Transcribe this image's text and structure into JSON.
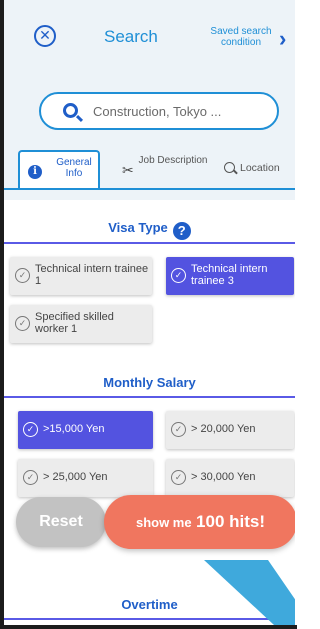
{
  "header": {
    "close_glyph": "✕",
    "title": "Search",
    "saved_link": "Saved search condition",
    "chevron_glyph": "›"
  },
  "search": {
    "placeholder": "Construction, Tokyo ..."
  },
  "tabs": [
    {
      "icon": "info-icon",
      "label": "General Info",
      "active": true
    },
    {
      "icon": "tools-icon",
      "label": "Job Description",
      "active": false
    },
    {
      "icon": "location-search-icon",
      "label": "Location",
      "active": false
    }
  ],
  "visa_type": {
    "title": "Visa Type",
    "help_glyph": "?",
    "options": [
      {
        "label": "Technical intern trainee 1",
        "selected": false
      },
      {
        "label": "Technical intern trainee 3",
        "selected": true
      },
      {
        "label": "Specified skilled worker 1",
        "selected": false
      }
    ]
  },
  "monthly_salary": {
    "title": "Monthly Salary",
    "options": [
      {
        "label": ">15,000 Yen",
        "selected": true
      },
      {
        "label": "> 20,000 Yen",
        "selected": false
      },
      {
        "label": "> 25,000 Yen",
        "selected": false
      },
      {
        "label": "> 30,000 Yen",
        "selected": false
      }
    ]
  },
  "overtime": {
    "title": "Overtime"
  },
  "actions": {
    "reset_label": "Reset",
    "show_prefix": "show me",
    "show_count": "100 hits!"
  },
  "colors": {
    "accent": "#1f8fd6",
    "primary": "#1f5ec8",
    "selected_chip": "#5353e0",
    "cta": "#f0765f",
    "pointer": "#3fa9dc"
  }
}
